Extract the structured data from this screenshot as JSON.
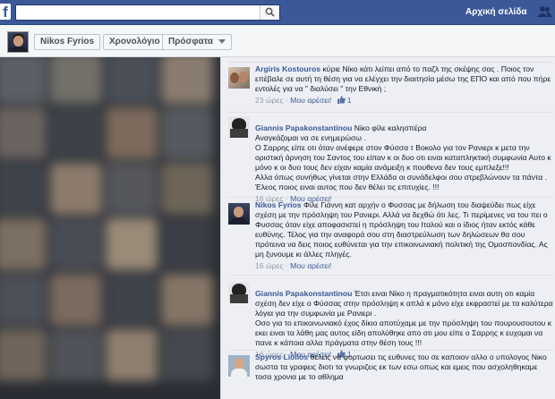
{
  "topbar": {
    "logo": "f",
    "home_label": "Αρχική σελίδα",
    "search_placeholder": ""
  },
  "subbar": {
    "profile_name": "Nikos Fyrios",
    "timeline_label": "Χρονολόγιο",
    "recent_label": "Πρόσφατα"
  },
  "comments": [
    {
      "author": "Argiris Kostouros",
      "text": " κύριε Νίκο κάτι λείπει από το παζλ της σκέψης σας . Ποιος τον επέβαλε σε αυτή τη θέση για να ελέγχει την διαιτησία μέσω της ΕΠΟ και από που πήρε εντολές για να \" διαλύσει \" την Εθνική ;",
      "time": "23 ώρες",
      "like_label": "Μου αρέσει!",
      "likes": "1"
    },
    {
      "author": "Giannis Papakonstantinou",
      "text": " Νίκο φίλε καλησπέρα\nΑναγκάζομαι να σε ενημερώσω .\nΟ Σαρρης είπε οτι όταν ανέφερε στον Φύσσα τ Βοκολο για τον Ρανιερι κ μετα την οριστική άρνηση του Σαντος του είπαν κ οι δυο οτι ειναι καταπληκτική συμφωνία Αυτο κ μόνο κ οι δυο τους δεν είχαν καμία ανάμειξη κ πουθενα δεν τους εμπλεξε!!!\nΑλλα όπως συνήθως γίνεται στην Ελλάδα οι συνάδελφοι σου στρεβλώνουν τα πάντα .\nΈλεος ποιος ειναι αυτος που δεν θέλει τις επιτυχίες. !!!",
      "time": "16 ώρες",
      "like_label": "Μου αρέσει!",
      "likes": ""
    },
    {
      "author": "Nikos Fyrios",
      "text": " Φίλε Γιάννη κατ αρχήν ο Φυσσας με δήλωση του διαψεύδει πως είχε σχέση με την πρόσληψη του Ρανιερι. Αλλά να δεχθώ ότι λες. Τι περίμενες να του πει ο Φυσσας όταν είχε αποφασιστεί η πρόσληψη του Ιταλού και ο ίδιος ήταν εκτός κάθε ευθύνης. Τέλος για την αναφορά σου στη διαστρεύλωση των δηλώσεων θα σου πρότεινα να δεις ποιος ευθύνεται για την επικοινωνιακή πολιτική της Ομοσπονδίας. Ας μη ξυνουμε κι άλλες πληγές.",
      "time": "16 ώρες",
      "like_label": "Μου αρέσει!",
      "likes": ""
    },
    {
      "author": "Giannis Papakonstantinou",
      "text": " Έτσι ειναι Νίκο η πραγματικότητα ειναι αυτη οτι καμία σχέση δεν είχε ο Φύσσας στην πρόσληψη κ απλά κ μόνο είχε εκφραστεί με τα καλύτερα λόγια για την συμφωνία με Ρανιερι .\nΟσο για το επικοινωνιακό έχος δίκιο αποτύχαμε με την πρόσληψη του πουρουσουτου κ εκει ειναι τα λάθη μας αυτος είδη απολύθηκε απο οτι μου είπε ο Σαρρης κ ευχομαι να πανε κ κάποια αλλα πράγματα στην θέση τους !!!",
      "time": "16 ώρες",
      "like_label": "Μου αρέσει!",
      "likes": "1"
    },
    {
      "author": "Spyros Liolios",
      "text": " θελεις να φορτωσει τις ευθυνες του σε καποιον αλλο ο υπολογος Νικο σωστα τα γραφεις διοτι τα γνωριζεις εκ των εσω οπως και εμεις που ασχοληθηκαμε τοσα χρονια με το αθλημα",
      "time": "",
      "like_label": "",
      "likes": ""
    }
  ]
}
